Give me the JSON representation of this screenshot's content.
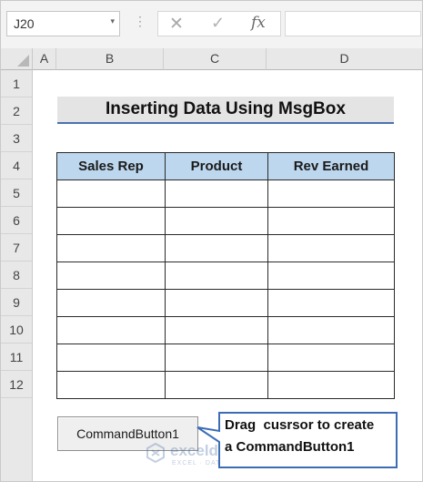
{
  "formula_bar": {
    "name_box": "J20",
    "name_box_caret": "▾",
    "dots": "⋮",
    "cancel_glyph": "✕",
    "enter_glyph": "✓",
    "fx_glyph": "fx",
    "formula": ""
  },
  "columns": [
    "A",
    "B",
    "C",
    "D"
  ],
  "rows": [
    "1",
    "2",
    "3",
    "4",
    "5",
    "6",
    "7",
    "8",
    "9",
    "10",
    "11",
    "12"
  ],
  "sheet": {
    "title": "Inserting Data Using MsgBox",
    "table": {
      "headers": [
        "Sales Rep",
        "Product",
        "Rev Earned"
      ],
      "body_rows": [
        [
          "",
          "",
          ""
        ],
        [
          "",
          "",
          ""
        ],
        [
          "",
          "",
          ""
        ],
        [
          "",
          "",
          ""
        ],
        [
          "",
          "",
          ""
        ],
        [
          "",
          "",
          ""
        ],
        [
          "",
          "",
          ""
        ],
        [
          "",
          "",
          ""
        ]
      ]
    }
  },
  "command_button": {
    "label": "CommandButton1"
  },
  "callout": {
    "line1": "Drag  cusrsor to create",
    "line2": "a CommandButton1"
  },
  "watermark": {
    "name": "exceldemy",
    "tagline": "EXCEL · DATA · BI"
  },
  "colors": {
    "header_fill": "#bdd7ee",
    "title_fill": "#e4e4e4",
    "title_underline": "#4a72b0",
    "callout_border": "#3d6cb5"
  },
  "icons": {
    "cancel": "close-icon",
    "enter": "check-icon",
    "function": "fx-icon",
    "dropdown": "chevron-down-icon"
  }
}
